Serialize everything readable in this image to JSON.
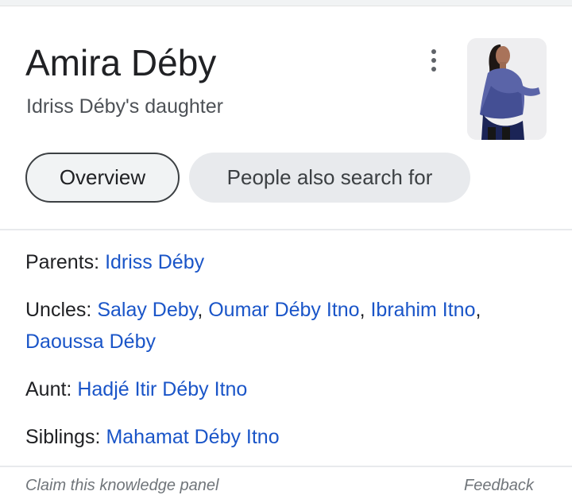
{
  "card": {
    "title": "Amira Déby",
    "subtitle": "Idriss Déby's daughter",
    "more_options_icon": "more-vert-icon",
    "thumbnail_icon": "person-photo"
  },
  "chips": {
    "overview": "Overview",
    "people": "People also search for"
  },
  "facts": {
    "parents": {
      "label": "Parents: ",
      "links": [
        "Idriss Déby"
      ]
    },
    "uncles": {
      "label": "Uncles: ",
      "links": [
        "Salay Deby",
        "Oumar Déby Itno",
        "Ibrahim Itno",
        "Daoussa Déby"
      ],
      "separator": ", "
    },
    "aunt": {
      "label": "Aunt: ",
      "links": [
        "Hadjé Itir Déby Itno"
      ]
    },
    "siblings": {
      "label": "Siblings: ",
      "links": [
        "Mahamat Déby Itno"
      ]
    }
  },
  "footer": {
    "left": "Claim this knowledge panel",
    "right": "Feedback"
  },
  "colors": {
    "link": "#1a55c8",
    "text": "#202124",
    "muted": "#4d5156",
    "chip_bg": "#e8eaed"
  }
}
